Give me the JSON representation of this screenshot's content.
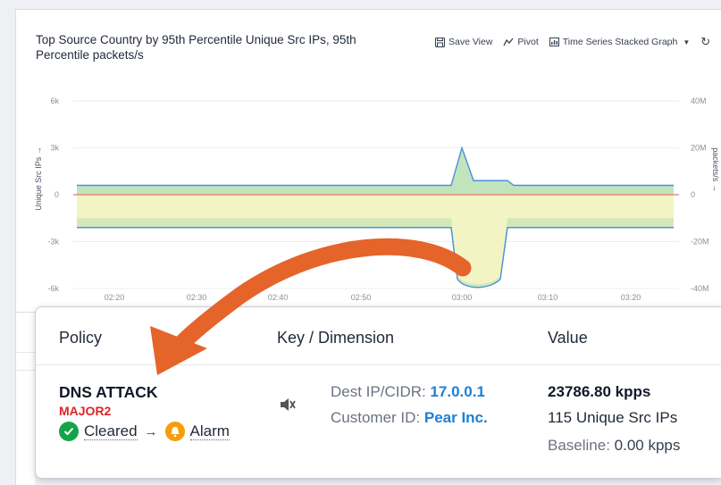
{
  "chart": {
    "title": "Top Source Country by 95th Percentile Unique Src IPs, 95th Percentile packets/s",
    "toolbar": {
      "save_view": "Save View",
      "pivot": "Pivot",
      "chart_type": "Time Series Stacked Graph"
    },
    "y_left_label": "Unique Src IPs →",
    "y_right_label": "packets/s →"
  },
  "chart_data": {
    "type": "area",
    "x_ticks": [
      "02:20",
      "02:30",
      "02:40",
      "02:50",
      "03:00",
      "03:10",
      "03:20"
    ],
    "y_left_ticks": [
      "6k",
      "3k",
      "0",
      "-3k",
      "-6k"
    ],
    "y_right_ticks": [
      "40M",
      "20M",
      "0",
      "-20M",
      "-40M"
    ],
    "ylim_left": [
      -6000,
      6000
    ],
    "ylim_right": [
      -40000000,
      40000000
    ],
    "series": [
      {
        "values_upper": [
          600,
          600,
          600,
          600,
          3000,
          600,
          600,
          600
        ],
        "values_lower": [
          -2100,
          -2100,
          -2100,
          -2100,
          -5900,
          -2100,
          -2100,
          -2100
        ]
      }
    ],
    "colors": {
      "upper_band": "#b7dfb2",
      "lower_band": "#f2f3c1",
      "line": "#4a90d9",
      "zero_line": "#e07b6a"
    }
  },
  "card": {
    "headers": {
      "policy": "Policy",
      "key_dimension": "Key / Dimension",
      "value": "Value"
    },
    "policy": {
      "name": "DNS ATTACK",
      "severity": "MAJOR2",
      "from_state": "Cleared",
      "arrow": "→",
      "to_state": "Alarm"
    },
    "dimension": {
      "dest_label": "Dest IP/CIDR: ",
      "dest_value": "17.0.0.1",
      "customer_label": "Customer ID: ",
      "customer_value": "Pear Inc."
    },
    "value": {
      "main": "23786.80 kpps",
      "unique_src": "115 Unique Src IPs",
      "baseline_label": "Baseline: ",
      "baseline_value": "0.00 kpps"
    }
  },
  "colors": {
    "accent_arrow": "#e5642a",
    "severity": "#dc2626",
    "cleared": "#16a34a",
    "alarm": "#f59e0b",
    "link_blue": "#1d7fd6"
  }
}
